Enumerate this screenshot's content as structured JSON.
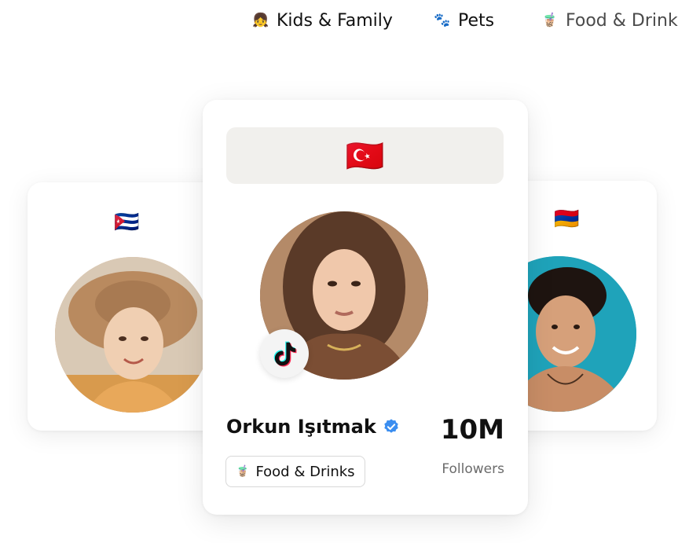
{
  "categories": [
    {
      "emoji": "👧",
      "label": "Kids & Family"
    },
    {
      "emoji": "🐾",
      "label": "Pets"
    },
    {
      "emoji": "🧋",
      "label": "Food & Drink"
    }
  ],
  "cards": {
    "left": {
      "flag": "🇨🇺"
    },
    "right": {
      "flag": "🇦🇲"
    },
    "main": {
      "flag": "🇹🇷",
      "platform": "tiktok-icon",
      "name": "Orkun Işıtmak",
      "followers_count": "10M",
      "followers_label": "Followers",
      "category_chip": {
        "emoji": "🧋",
        "label": "Food & Drinks"
      }
    }
  },
  "colors": {
    "verified": "#3b8ef0",
    "banner_bg": "#f1f0ed",
    "tiktok_cyan": "#25f4ee",
    "tiktok_red": "#fe2c55"
  }
}
